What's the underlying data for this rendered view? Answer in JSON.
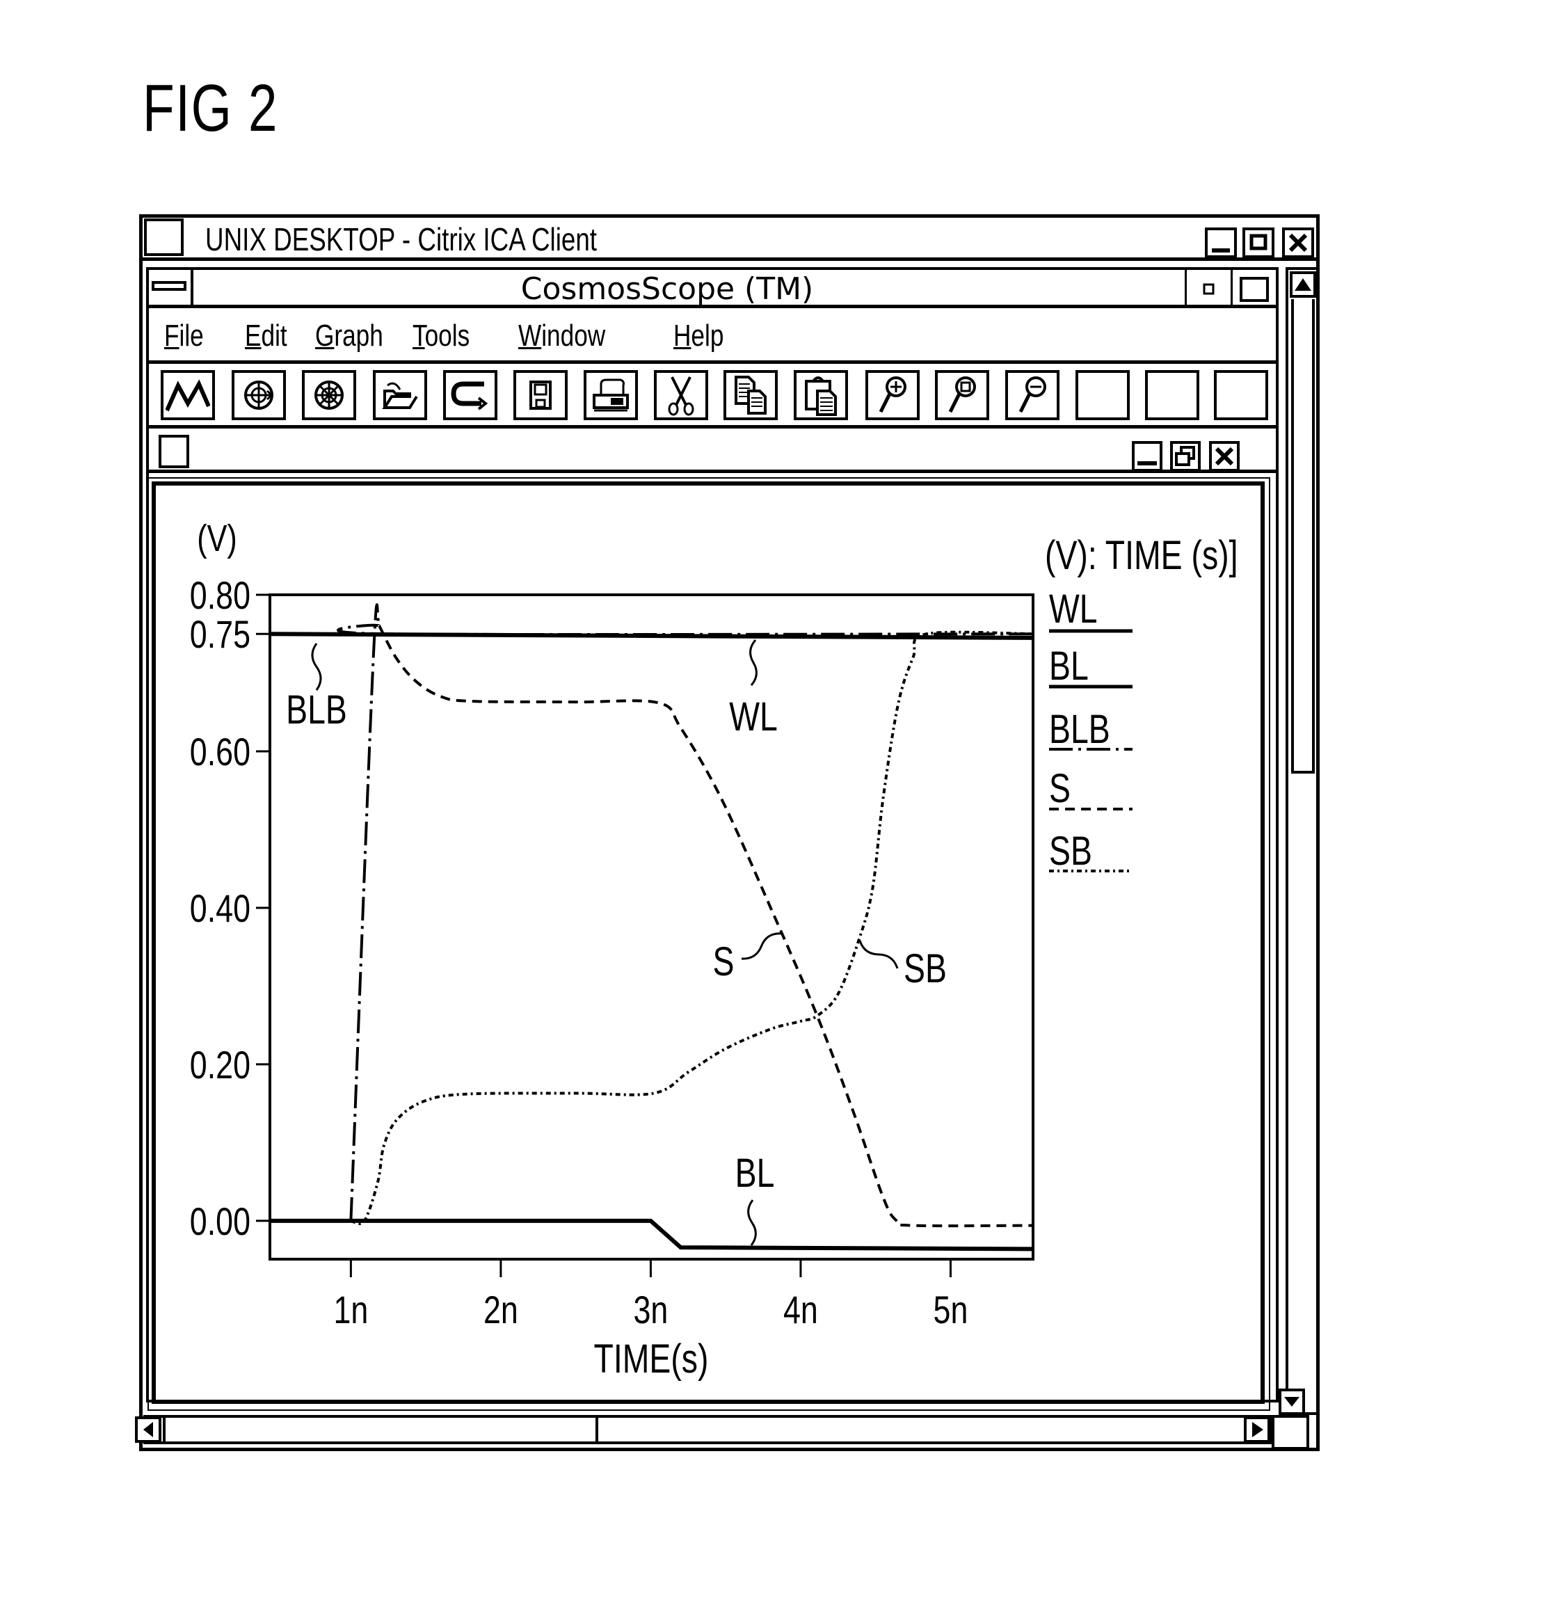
{
  "figure_label": "FIG 2",
  "outer_window": {
    "title": "UNIX DESKTOP - Citrix ICA Client",
    "buttons": [
      "minimize",
      "maximize",
      "close"
    ]
  },
  "app_window": {
    "title": "CosmosScope (TM)",
    "menu": [
      {
        "label": "File",
        "accel": "F"
      },
      {
        "label": "Edit",
        "accel": "E"
      },
      {
        "label": "Graph",
        "accel": "G"
      },
      {
        "label": "Tools",
        "accel": "T"
      },
      {
        "label": "Window",
        "accel": "W"
      },
      {
        "label": "Help",
        "accel": "H"
      }
    ],
    "toolbar": [
      {
        "name": "waveform-button",
        "icon": "waveform-icon"
      },
      {
        "name": "globe-arrow-button",
        "icon": "globe-arrow-icon"
      },
      {
        "name": "globe-star-button",
        "icon": "globe-star-icon"
      },
      {
        "name": "open-button",
        "icon": "open-folder-icon"
      },
      {
        "name": "redo-button",
        "icon": "curved-arrow-icon"
      },
      {
        "name": "save-button",
        "icon": "floppy-icon"
      },
      {
        "name": "print-button",
        "icon": "printer-icon"
      },
      {
        "name": "cut-button",
        "icon": "scissors-icon"
      },
      {
        "name": "copy-button",
        "icon": "copy-icon"
      },
      {
        "name": "paste-button",
        "icon": "paste-icon"
      },
      {
        "name": "zoom-in-button",
        "icon": "zoom-in-icon"
      },
      {
        "name": "zoom-box-button",
        "icon": "zoom-box-icon"
      },
      {
        "name": "zoom-out-button",
        "icon": "zoom-out-icon"
      },
      {
        "name": "blank-button-1",
        "icon": ""
      },
      {
        "name": "blank-button-2",
        "icon": ""
      },
      {
        "name": "blank-button-3",
        "icon": ""
      }
    ],
    "child_window_buttons": [
      "minimize",
      "restore",
      "close"
    ]
  },
  "chart_data": {
    "type": "line",
    "title": "",
    "ylabel": "(V)",
    "xlabel": "TIME(s)",
    "legend_header": "(V): TIME (s)]",
    "legend_position": "right",
    "xlim": [
      0.46,
      5.55
    ],
    "ylim": [
      -0.049,
      0.8
    ],
    "x_unit": "ns",
    "x_ticks": [
      {
        "value": 1,
        "label": "1n"
      },
      {
        "value": 2,
        "label": "2n"
      },
      {
        "value": 3,
        "label": "3n"
      },
      {
        "value": 4,
        "label": "4n"
      },
      {
        "value": 5,
        "label": "5n"
      }
    ],
    "y_ticks": [
      {
        "value": 0.8,
        "label": "0.80"
      },
      {
        "value": 0.75,
        "label": "0.75"
      },
      {
        "value": 0.6,
        "label": "0.60"
      },
      {
        "value": 0.4,
        "label": "0.40"
      },
      {
        "value": 0.2,
        "label": "0.20"
      },
      {
        "value": 0.0,
        "label": "0.00"
      }
    ],
    "grid": false,
    "series": [
      {
        "name": "WL",
        "style": "solid-thick",
        "x": [
          0.46,
          5.55
        ],
        "y": [
          0.75,
          0.745
        ]
      },
      {
        "name": "BL",
        "style": "solid-thick",
        "x": [
          0.46,
          3.0,
          3.2,
          5.55
        ],
        "y": [
          0.0,
          0.0,
          -0.034,
          -0.036
        ]
      },
      {
        "name": "BLB",
        "style": "dash-dot",
        "x": [
          1.0,
          1.15,
          1.19,
          1.25,
          5.55
        ],
        "y": [
          0.0,
          0.72,
          0.76,
          0.75,
          0.75
        ]
      },
      {
        "name": "S",
        "style": "dashed",
        "x": [
          1.19,
          1.3,
          1.43,
          1.6,
          1.81,
          2.5,
          3.05,
          3.2,
          3.47,
          3.8,
          4.11,
          4.35,
          4.55,
          4.64,
          4.75,
          5.55
        ],
        "y": [
          0.76,
          0.72,
          0.69,
          0.67,
          0.664,
          0.663,
          0.662,
          0.63,
          0.54,
          0.4,
          0.262,
          0.14,
          0.03,
          0.0,
          -0.006,
          -0.006
        ]
      },
      {
        "name": "SB",
        "style": "dotted",
        "x": [
          1.0,
          1.09,
          1.18,
          1.22,
          1.31,
          1.49,
          1.77,
          2.5,
          3.02,
          3.25,
          3.5,
          3.8,
          4.0,
          4.11,
          4.25,
          4.39,
          4.48,
          4.55,
          4.65,
          4.75,
          4.84,
          5.55
        ],
        "y": [
          0.0,
          0.0,
          0.05,
          0.096,
          0.13,
          0.153,
          0.162,
          0.163,
          0.163,
          0.19,
          0.22,
          0.245,
          0.255,
          0.262,
          0.29,
          0.36,
          0.425,
          0.54,
          0.66,
          0.72,
          0.75,
          0.75
        ]
      }
    ],
    "annotations": [
      {
        "text": "BLB",
        "target_series": "BLB",
        "at_x": 0.73,
        "at_y": 0.75
      },
      {
        "text": "WL",
        "target_series": "WL",
        "at_x": 3.7,
        "at_y": 0.75
      },
      {
        "text": "S",
        "target_series": "S",
        "at_x": 3.84,
        "at_y": 0.37
      },
      {
        "text": "SB",
        "target_series": "SB",
        "at_x": 4.37,
        "at_y": 0.36
      },
      {
        "text": "BL",
        "target_series": "BL",
        "at_x": 3.68,
        "at_y": -0.034
      }
    ]
  }
}
